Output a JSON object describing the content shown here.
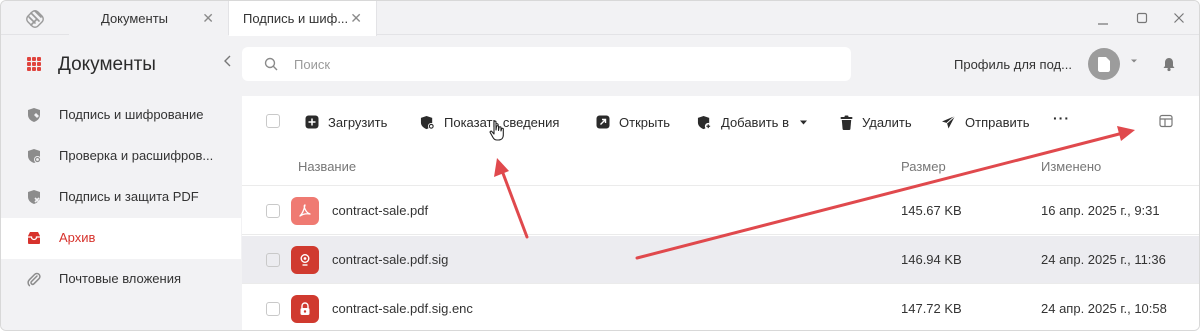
{
  "tabs": [
    {
      "label": "Документы"
    },
    {
      "label": "Подпись и шиф..."
    }
  ],
  "window_controls": {
    "close": "✕"
  },
  "sidebar": {
    "title": "Документы",
    "items": [
      {
        "label": "Подпись и шифрование",
        "icon": "shield-pen-icon"
      },
      {
        "label": "Проверка и расшифров...",
        "icon": "shield-refresh-icon"
      },
      {
        "label": "Подпись и защита PDF",
        "icon": "shield-pdf-icon"
      },
      {
        "label": "Архив",
        "icon": "archive-icon",
        "active": true
      },
      {
        "label": "Почтовые вложения",
        "icon": "paperclip-icon"
      }
    ]
  },
  "search": {
    "placeholder": "Поиск"
  },
  "profile": {
    "label": "Профиль для под..."
  },
  "toolbar": {
    "upload": "Загрузить",
    "show_info": "Показать сведения",
    "open": "Открыть",
    "add_to": "Добавить в",
    "delete": "Удалить",
    "send": "Отправить",
    "more": "···"
  },
  "table": {
    "columns": {
      "name": "Название",
      "size": "Размер",
      "modified": "Изменено"
    },
    "rows": [
      {
        "name": "contract-sale.pdf",
        "size": "145.67 KB",
        "modified": "16 апр. 2025 г., 9:31",
        "icon": "pdf-icon"
      },
      {
        "name": "contract-sale.pdf.sig",
        "size": "146.94 KB",
        "modified": "24 апр. 2025 г., 11:36",
        "icon": "signature-seal-icon"
      },
      {
        "name": "contract-sale.pdf.sig.enc",
        "size": "147.72 KB",
        "modified": "24 апр. 2025 г., 10:58",
        "icon": "encrypted-lock-icon"
      }
    ]
  },
  "colors": {
    "accent": "#d7322c",
    "annotation": "#e0494d",
    "pdf_tile": "#ef7a72",
    "sig_tile": "#d03a2f"
  }
}
